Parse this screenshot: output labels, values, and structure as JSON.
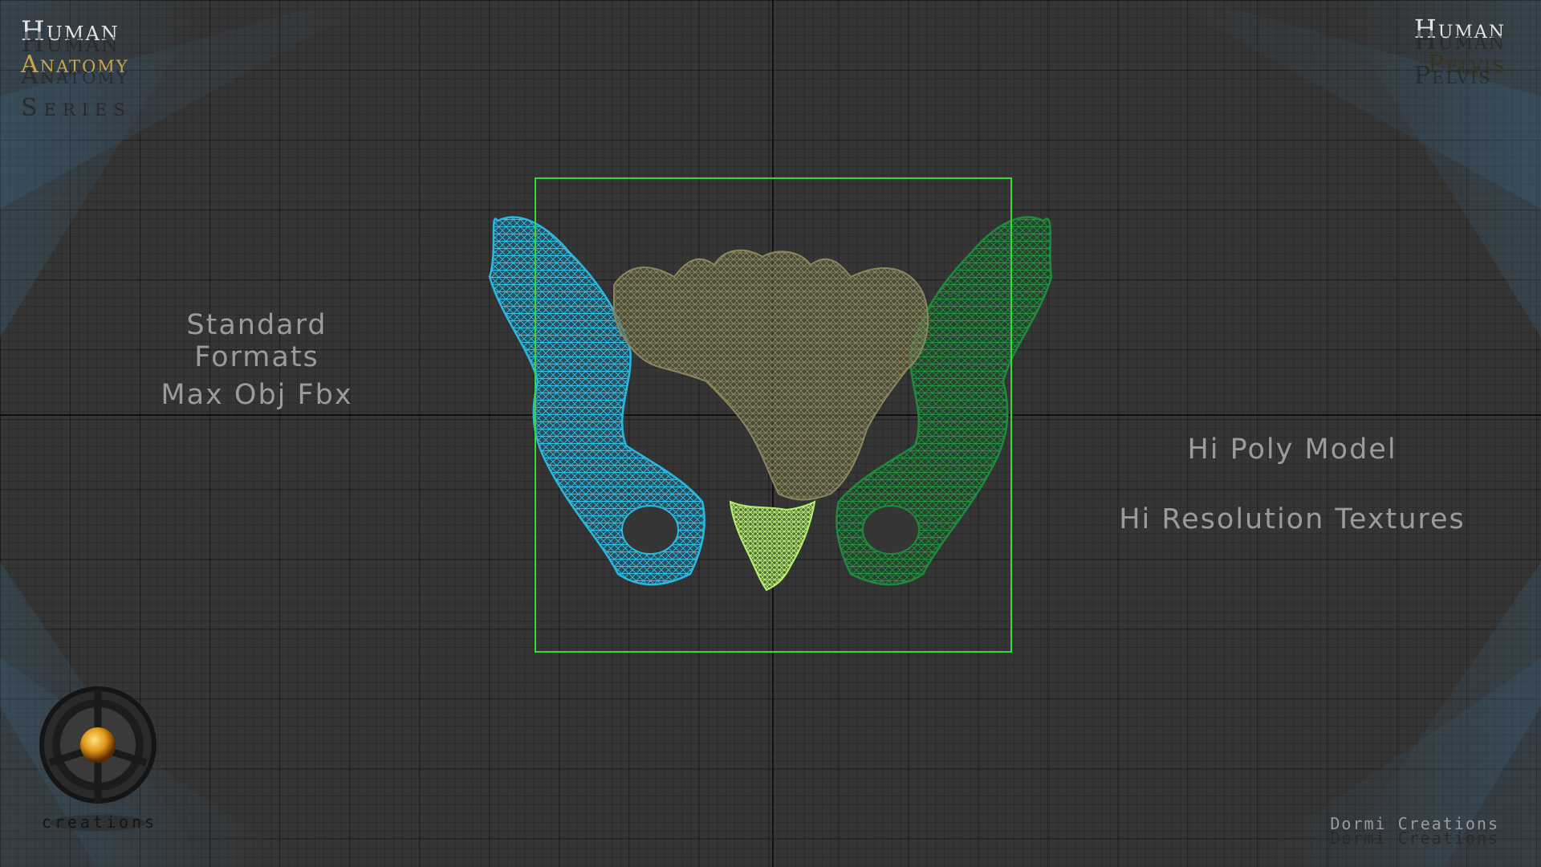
{
  "header_left": {
    "line1": "Human",
    "line2": "Anatomy",
    "line3": "Series"
  },
  "header_right": {
    "line1": "Human",
    "line2": "Pelvis"
  },
  "left_info": {
    "formats_title": "Standard Formats",
    "formats_list": "Max Obj Fbx"
  },
  "right_info": {
    "poly": "Hi Poly Model",
    "textures": "Hi Resolution Textures"
  },
  "logo": {
    "text": "creations"
  },
  "footer": {
    "credit": "Dormi Creations"
  },
  "colors": {
    "background": "#353535",
    "left_hip": "#2ab8e0",
    "right_hip": "#1f8a3c",
    "sacrum": "#8a875f",
    "coccyx": "#b8f070",
    "bounding_box": "#36d936",
    "title_gold": "#c9a64a"
  },
  "icons": [
    "logo-wheel-icon",
    "pelvis-wireframe"
  ]
}
